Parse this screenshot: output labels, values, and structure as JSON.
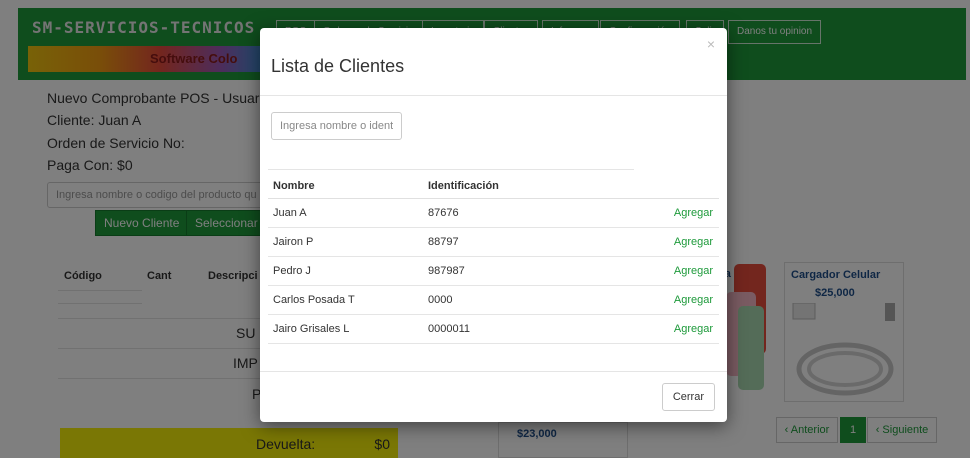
{
  "navbar": {
    "brand": "SM-SERVICIOS-TECNICOS",
    "brand_sub": "Software Colo",
    "menu": [
      "POS",
      "Ordenes de Servicio",
      "Inventario",
      "Clientes",
      "Informes",
      "Configuración",
      "Salir"
    ],
    "opinion": "Danos tu opinion"
  },
  "pos": {
    "title": "Nuevo Comprobante POS - Usuar",
    "cliente": "Cliente: Juan A",
    "orden": "Orden de Servicio No:",
    "paga": "Paga Con: $0",
    "search_placeholder": "Ingresa nombre o codigo del producto qu",
    "nuevo_cliente": "Nuevo Cliente",
    "seleccionar": "Seleccionar",
    "table_headers": [
      "Código",
      "Cant",
      "Descripci"
    ],
    "subtotal_label": "SU",
    "impuesto_label": "IMP",
    "total_label": "P",
    "devuelta_label": "Devuelta:",
    "devuelta_value": "$0"
  },
  "products": [
    {
      "title": "Cargador Celular",
      "price": "$25,000"
    },
    {
      "title": "na",
      "price": ""
    },
    {
      "title": "",
      "price": "$23,000"
    }
  ],
  "pagination": {
    "prev": "‹ Anterior",
    "page": "1",
    "next": "‹ Siguiente"
  },
  "modal": {
    "title": "Lista de Clientes",
    "close": "×",
    "search_placeholder": "Ingresa nombre o ident",
    "headers": {
      "name": "Nombre",
      "id": "Identificación"
    },
    "rows": [
      {
        "name": "Juan A",
        "id": "87676",
        "action": "Agregar"
      },
      {
        "name": "Jairon P",
        "id": "88797",
        "action": "Agregar"
      },
      {
        "name": "Pedro J",
        "id": "987987",
        "action": "Agregar"
      },
      {
        "name": "Carlos Posada T",
        "id": "0000",
        "action": "Agregar"
      },
      {
        "name": "Jairo Grisales L",
        "id": "0000011",
        "action": "Agregar"
      }
    ],
    "cerrar": "Cerrar"
  },
  "colors": {
    "primary_green": "#1e9a3b",
    "devuelta_yellow": "#f5ee0a",
    "link_green": "#1e9a3b"
  }
}
